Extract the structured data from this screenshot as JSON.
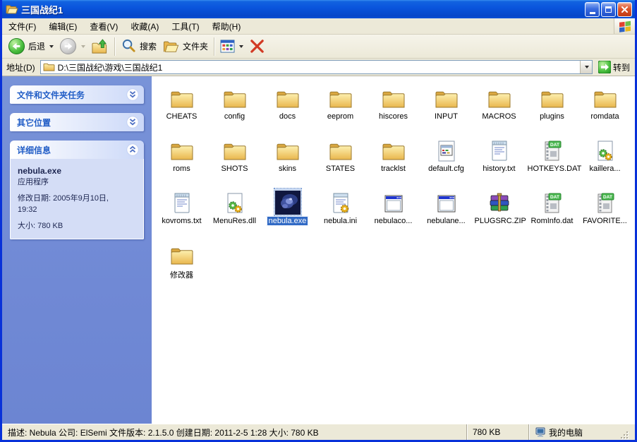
{
  "colors": {
    "titlebar_blue": "#0a55dd",
    "window_border": "#0831d9",
    "sidebar_blue": "#7089d5",
    "panel_title_blue": "#215dc6",
    "selection_blue": "#316ac5",
    "toolbar_bg": "#ece9d8",
    "folder_yellow": "#e9b64d",
    "go_green": "#3fae3f"
  },
  "window": {
    "title": "三国战纪1"
  },
  "menu": {
    "items": [
      "文件(F)",
      "编辑(E)",
      "查看(V)",
      "收藏(A)",
      "工具(T)",
      "帮助(H)"
    ]
  },
  "toolbar": {
    "back_label": "后退",
    "search_label": "搜索",
    "folders_label": "文件夹"
  },
  "address": {
    "label": "地址(D)",
    "path": "D:\\三国战纪\\游戏\\三国战纪1",
    "go_label": "转到"
  },
  "sidebar": {
    "tasks_panel": {
      "title": "文件和文件夹任务"
    },
    "places_panel": {
      "title": "其它位置"
    },
    "details_panel": {
      "title": "详细信息",
      "filename": "nebula.exe",
      "filetype": "应用程序",
      "modified_line1": "修改日期: 2005年9月10日,",
      "modified_line2": "19:32",
      "size": "大小: 780 KB"
    }
  },
  "files": {
    "items": [
      {
        "label": "CHEATS",
        "type": "folder"
      },
      {
        "label": "config",
        "type": "folder"
      },
      {
        "label": "docs",
        "type": "folder"
      },
      {
        "label": "eeprom",
        "type": "folder"
      },
      {
        "label": "hiscores",
        "type": "folder"
      },
      {
        "label": "INPUT",
        "type": "folder"
      },
      {
        "label": "MACROS",
        "type": "folder"
      },
      {
        "label": "plugins",
        "type": "folder"
      },
      {
        "label": "romdata",
        "type": "folder"
      },
      {
        "label": "roms",
        "type": "folder"
      },
      {
        "label": "SHOTS",
        "type": "folder"
      },
      {
        "label": "skins",
        "type": "folder"
      },
      {
        "label": "STATES",
        "type": "folder"
      },
      {
        "label": "tracklst",
        "type": "folder"
      },
      {
        "label": "default.cfg",
        "type": "cfg"
      },
      {
        "label": "history.txt",
        "type": "txt"
      },
      {
        "label": "HOTKEYS.DAT",
        "type": "dat"
      },
      {
        "label": "kaillera...",
        "type": "dll"
      },
      {
        "label": "kovroms.txt",
        "type": "txt"
      },
      {
        "label": "MenuRes.dll",
        "type": "dll"
      },
      {
        "label": "nebula.exe",
        "type": "nebula",
        "selected": true
      },
      {
        "label": "nebula.ini",
        "type": "ini"
      },
      {
        "label": "nebulaco...",
        "type": "appwin"
      },
      {
        "label": "nebulane...",
        "type": "appwin"
      },
      {
        "label": "PLUGSRC.ZIP",
        "type": "zip"
      },
      {
        "label": "RomInfo.dat",
        "type": "dat"
      },
      {
        "label": "FAVORITE...",
        "type": "dat"
      },
      {
        "label": "修改器",
        "type": "folder"
      }
    ]
  },
  "statusbar": {
    "description": "描述: Nebula 公司: ElSemi 文件版本: 2.1.5.0 创建日期: 2011-2-5 1:28 大小: 780 KB",
    "size": "780 KB",
    "location": "我的电脑"
  }
}
